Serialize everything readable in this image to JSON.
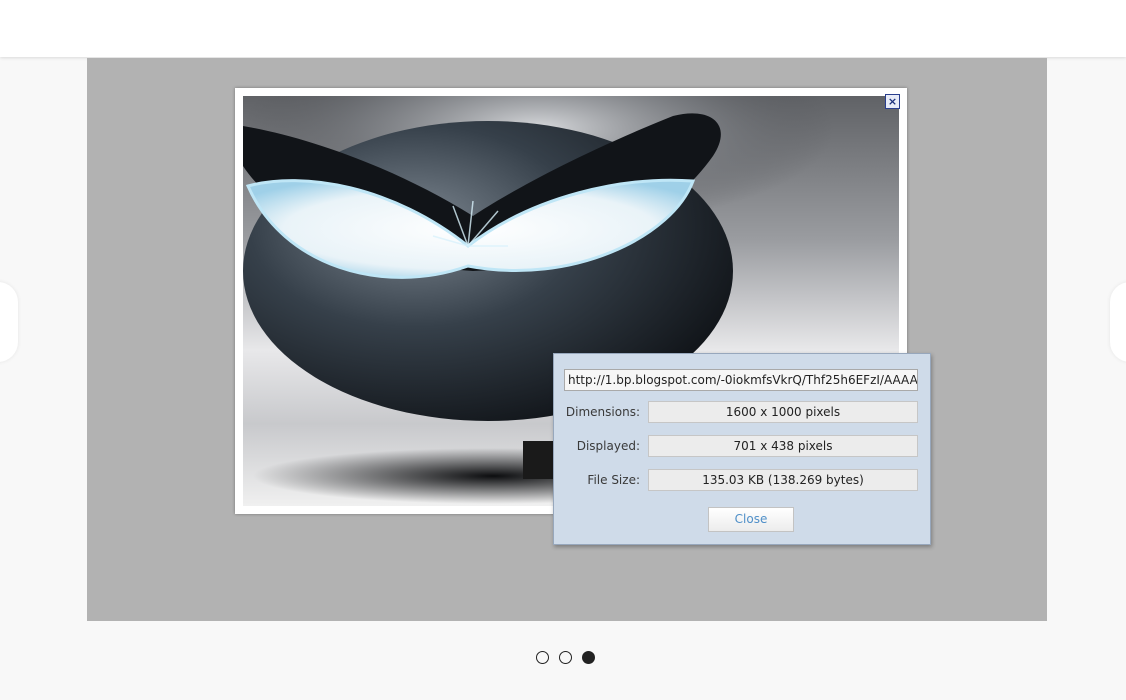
{
  "dialog": {
    "url": "http://1.bp.blogspot.com/-0iokmfsVkrQ/Thf25h6EFzI/AAAAA",
    "close_x": "×",
    "close_label": "Close",
    "rows": [
      {
        "label": "Dimensions:",
        "value": "1600 x 1000 pixels"
      },
      {
        "label": "Displayed:",
        "value": "701 x 438 pixels"
      },
      {
        "label": "File Size:",
        "value": "135.03 KB (138.269 bytes)"
      }
    ]
  },
  "carousel": {
    "slide_count": 3,
    "active_index": 2
  },
  "colors": {
    "stage_background": "#b2b2b2",
    "panel_background": "#cfdbe9",
    "close_link": "#4f8fc8"
  }
}
